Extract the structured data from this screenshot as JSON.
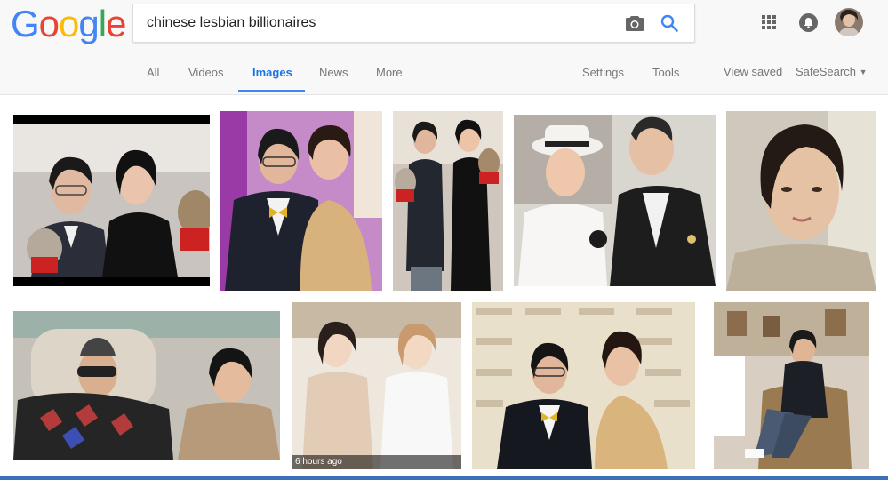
{
  "logo": {
    "letters": [
      {
        "ch": "G",
        "color": "#4285f4"
      },
      {
        "ch": "o",
        "color": "#ea4335"
      },
      {
        "ch": "o",
        "color": "#fbbc05"
      },
      {
        "ch": "g",
        "color": "#4285f4"
      },
      {
        "ch": "l",
        "color": "#34a853"
      },
      {
        "ch": "e",
        "color": "#ea4335"
      }
    ]
  },
  "search": {
    "query": "chinese lesbian billionaires"
  },
  "icons": {
    "camera": "camera-icon",
    "search": "search-icon",
    "apps": "apps-grid-icon",
    "notifications": "bell-icon",
    "avatar": "user-avatar"
  },
  "tabs": [
    {
      "label": "All",
      "active": false
    },
    {
      "label": "Videos",
      "active": false
    },
    {
      "label": "Images",
      "active": true
    },
    {
      "label": "News",
      "active": false
    },
    {
      "label": "More",
      "active": false
    }
  ],
  "tools": {
    "settings": "Settings",
    "tools": "Tools"
  },
  "right_links": {
    "view_saved": "View saved",
    "safesearch": "SafeSearch"
  },
  "results": [
    {
      "badge": ""
    },
    {
      "badge": ""
    },
    {
      "badge": ""
    },
    {
      "badge": ""
    },
    {
      "badge": ""
    },
    {
      "badge": ""
    },
    {
      "badge": "6 hours ago"
    },
    {
      "badge": ""
    },
    {
      "badge": ""
    }
  ],
  "colors": {
    "accent": "#4285f4",
    "header_bg": "#f8f8f8",
    "tab_text": "#777777"
  }
}
